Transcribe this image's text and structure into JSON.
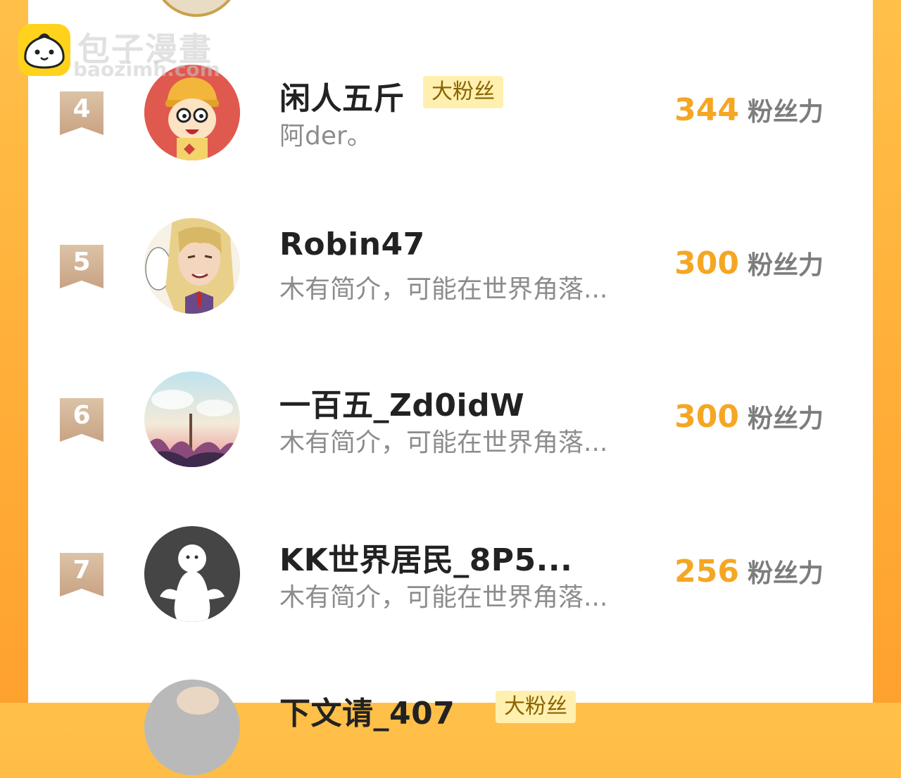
{
  "watermark": {
    "name": "包子漫畫",
    "url": "baozimh.com"
  },
  "list_unit": "粉丝力",
  "rows": [
    {
      "rank": "4",
      "name": "闲人五斤",
      "badge": "大粉丝",
      "bio": "阿der。",
      "score": "344",
      "unit": "粉丝力",
      "avatar": "cartoon-boy-yellow-hat"
    },
    {
      "rank": "5",
      "name": "Robin47",
      "badge": "",
      "bio": "木有简介，可能在世界角落...",
      "score": "300",
      "unit": "粉丝力",
      "avatar": "anime-blond-character"
    },
    {
      "rank": "6",
      "name": "一百五_Zd0idW",
      "badge": "",
      "bio": "木有简介，可能在世界角落...",
      "score": "300",
      "unit": "粉丝力",
      "avatar": "anime-crowd-scene"
    },
    {
      "rank": "7",
      "name": "KK世界居民_8P5...",
      "badge": "",
      "bio": "木有简介，可能在世界角落...",
      "score": "256",
      "unit": "粉丝力",
      "avatar": "default-ghost-avatar"
    },
    {
      "rank": "",
      "name": "下文请_407",
      "badge": "大粉丝",
      "bio": "",
      "score": "",
      "unit": "",
      "avatar": "partial-avatar"
    }
  ],
  "colors": {
    "accent": "#f5a623",
    "badge_bg": "#fff0b0",
    "rank_ribbon": "#c8a383"
  }
}
